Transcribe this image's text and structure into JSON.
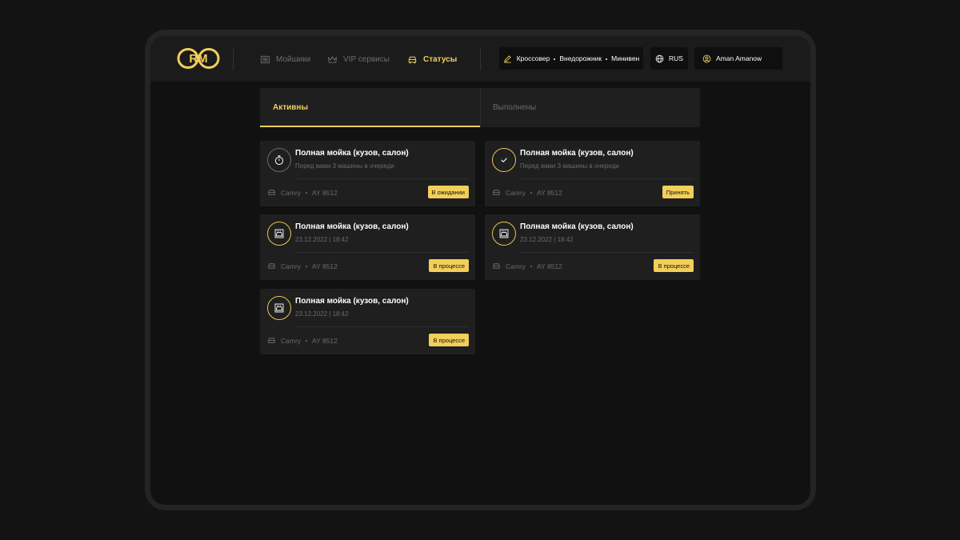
{
  "header": {
    "logo_text": "RM",
    "nav": [
      {
        "label": "Мойшики",
        "icon": "list-icon",
        "active": false
      },
      {
        "label": "VIP сервисы",
        "icon": "crown-icon",
        "active": false
      },
      {
        "label": "Статусы",
        "icon": "car-icon",
        "active": true
      }
    ],
    "vehicle_types": [
      "Кроссовер",
      "Внедорожник",
      "Минивен"
    ],
    "language": "RUS",
    "user_name": "Aman Amanow"
  },
  "tabs": [
    {
      "label": "Активны",
      "active": true
    },
    {
      "label": "Выполнены",
      "active": false
    }
  ],
  "orders": [
    {
      "title": "Полная мойка (кузов, салон)",
      "subtitle": "Перед вами 3 машины в очереди",
      "car_model": "Camry",
      "plate": "AY 8512",
      "status": "В ожидании",
      "icon": "stopwatch-icon"
    },
    {
      "title": "Полная мойка (кузов, салон)",
      "subtitle": "Перед вами 3 машины в очереди",
      "car_model": "Camry",
      "plate": "AY 8512",
      "status": "Принять",
      "icon": "check-icon"
    },
    {
      "title": "Полная мойка (кузов, салон)",
      "subtitle": "23.12.2022 | 18:42",
      "car_model": "Camry",
      "plate": "AY 8512",
      "status": "В процессе",
      "icon": "car-wash-icon"
    },
    {
      "title": "Полная мойка (кузов, салон)",
      "subtitle": "23.12.2022 | 18:42",
      "car_model": "Camry",
      "plate": "AY 8512",
      "status": "В процессе",
      "icon": "car-wash-icon"
    },
    {
      "title": "Полная мойка (кузов, салон)",
      "subtitle": "23.12.2022 | 18:42",
      "car_model": "Camry",
      "plate": "AY 8512",
      "status": "В процессе",
      "icon": "car-wash-icon"
    }
  ],
  "colors": {
    "accent": "#f2cf59",
    "background": "#111111",
    "card": "#1f1f1f",
    "muted_text": "#6a6a6a"
  }
}
